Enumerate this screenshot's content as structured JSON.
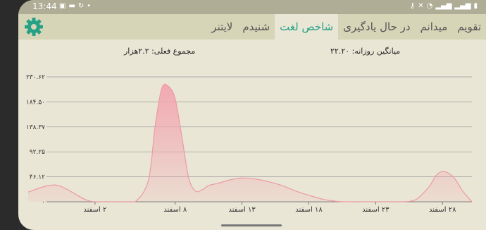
{
  "status_bar": {
    "time": "13:44",
    "left_icons": [
      "image-icon",
      "message-icon",
      "sync-icon",
      "dot-icon"
    ],
    "right_icons": [
      "key-icon",
      "mute-icon",
      "wifi-icon",
      "signal-icon",
      "signal-icon",
      "battery-icon"
    ]
  },
  "toolbar": {
    "settings_icon": "gear-icon",
    "accent": "#2a9d8f",
    "tabs": [
      "تقویم",
      "میدانم",
      "در حال یادگیری",
      "شاخص لغت",
      "شنیدم",
      "لایتنر"
    ],
    "active_tab": "شاخص لغت"
  },
  "stats": {
    "daily_average": "میانگین روزانه: ۲۲.۲۰",
    "current_total": "مجموع فعلی: ۲.۲هزار"
  },
  "chart_data": {
    "type": "area",
    "title": "",
    "xlabel": "",
    "ylabel": "",
    "y_ticks": [
      "۰",
      "۴۶.۱۲",
      "۹۲.۲۵",
      "۱۳۸.۳۷",
      "۱۸۴.۵۰",
      "۲۳۰.۶۲"
    ],
    "ylim": [
      0,
      230.62
    ],
    "x_ticks": [
      "۲ اسفند",
      "۸ اسفند",
      "۱۳ اسفند",
      "۱۸ اسفند",
      "۲۳ اسفند",
      "۲۸ اسفند"
    ],
    "x_tick_days": [
      2,
      8,
      13,
      18,
      23,
      28
    ],
    "grid": true,
    "fill_color": "#f2a5b0",
    "line_color": "#eb9aa7",
    "series": [
      {
        "x": [
          -3.0,
          -1.5,
          -0.5,
          1.2,
          2.0,
          3.0,
          4.0,
          5.0,
          6.0,
          6.5,
          7.0,
          7.5,
          8.0,
          8.5,
          9.0,
          9.5,
          10.0,
          10.5,
          11.0,
          11.5,
          12.0,
          13.0,
          14.0,
          15.0,
          16.0,
          17.0,
          18.0,
          19.0,
          20.0,
          21.0,
          22.0,
          23.0,
          24.0,
          25.0,
          26.0,
          27.0,
          27.5,
          28.0,
          28.5,
          29.0,
          29.5,
          30.2
        ],
        "y": [
          18,
          30,
          28,
          5,
          0,
          0,
          0,
          0,
          40,
          140,
          210,
          213,
          190,
          120,
          45,
          20,
          22,
          30,
          33,
          36,
          40,
          44,
          42,
          37,
          30,
          20,
          12,
          5,
          1,
          0,
          0,
          0,
          0,
          0,
          4,
          28,
          48,
          56,
          52,
          40,
          20,
          0
        ]
      }
    ]
  }
}
